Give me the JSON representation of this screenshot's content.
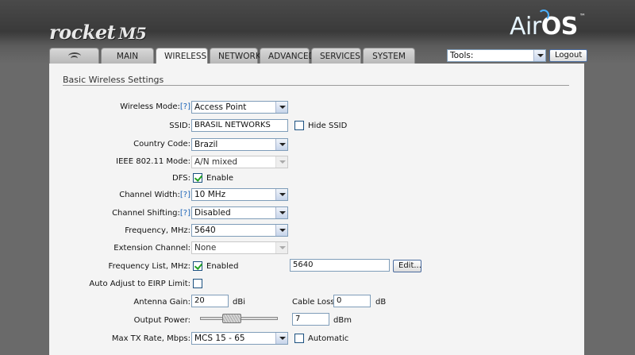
{
  "brand": {
    "product": "rocket",
    "model": "M5",
    "os_air": "Air",
    "os_os": "OS",
    "tm": "™"
  },
  "tabs": [
    {
      "label": "",
      "icon": "ubiquiti-logo-icon"
    },
    {
      "label": "MAIN"
    },
    {
      "label": "WIRELESS",
      "active": true
    },
    {
      "label": "NETWORK"
    },
    {
      "label": "ADVANCED"
    },
    {
      "label": "SERVICES"
    },
    {
      "label": "SYSTEM"
    }
  ],
  "tools": {
    "selected": "Tools:",
    "logout_label": "Logout"
  },
  "section": {
    "title": "Basic Wireless Settings"
  },
  "form": {
    "wireless_mode": {
      "label": "Wireless Mode:",
      "help": "[?]",
      "value": "Access Point"
    },
    "ssid": {
      "label": "SSID:",
      "value": "BRASIL NETWORKS",
      "hide_label": "Hide SSID",
      "hide_checked": false
    },
    "country_code": {
      "label": "Country Code:",
      "value": "Brazil"
    },
    "ieee_mode": {
      "label": "IEEE 802.11 Mode:",
      "value": "A/N mixed"
    },
    "dfs": {
      "label": "DFS:",
      "checkbox_label": "Enable",
      "checked": true
    },
    "channel_width": {
      "label": "Channel Width:",
      "help": "[?]",
      "value": "10 MHz"
    },
    "channel_shifting": {
      "label": "Channel Shifting:",
      "help": "[?]",
      "value": "Disabled"
    },
    "frequency": {
      "label": "Frequency, MHz:",
      "value": "5640"
    },
    "extension_channel": {
      "label": "Extension Channel:",
      "value": "None"
    },
    "frequency_list": {
      "label": "Frequency List, MHz:",
      "checkbox_label": "Enabled",
      "checked": true,
      "value": "5640",
      "edit_label": "Edit..."
    },
    "auto_adjust": {
      "label": "Auto Adjust to EIRP Limit:",
      "checked": false
    },
    "antenna_gain": {
      "label": "Antenna Gain:",
      "value": "20",
      "unit": "dBi"
    },
    "cable_loss": {
      "label": "Cable Loss:",
      "value": "0",
      "unit": "dB"
    },
    "output_power": {
      "label": "Output Power:",
      "value": "7",
      "unit": "dBm",
      "slider_fraction": 0.38
    },
    "max_tx_rate": {
      "label": "Max TX Rate, Mbps:",
      "value": "MCS 15 - 65",
      "auto_label": "Automatic",
      "auto_checked": false
    }
  }
}
